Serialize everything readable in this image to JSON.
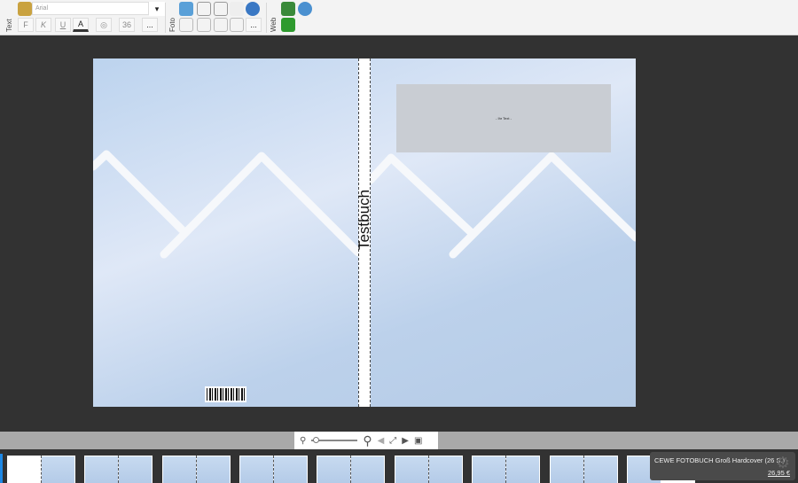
{
  "toolbar": {
    "groups": {
      "text": "Text",
      "foto": "Foto",
      "web": "Web"
    },
    "font_name": "Arial",
    "font_size": "36",
    "bold": "F",
    "italic": "K",
    "underline": "U",
    "font_color": "A",
    "more": "..."
  },
  "cover": {
    "spine_title": "Testbuch",
    "placeholder_text": "- Ihr Text -"
  },
  "product": {
    "name": "CEWE FOTOBUCH Groß Hardcover  (26 S.)",
    "price": "26,95 €"
  },
  "colors": {
    "background": "#323232",
    "toolbar": "#f3f3f3",
    "accent": "#1e88e5"
  }
}
